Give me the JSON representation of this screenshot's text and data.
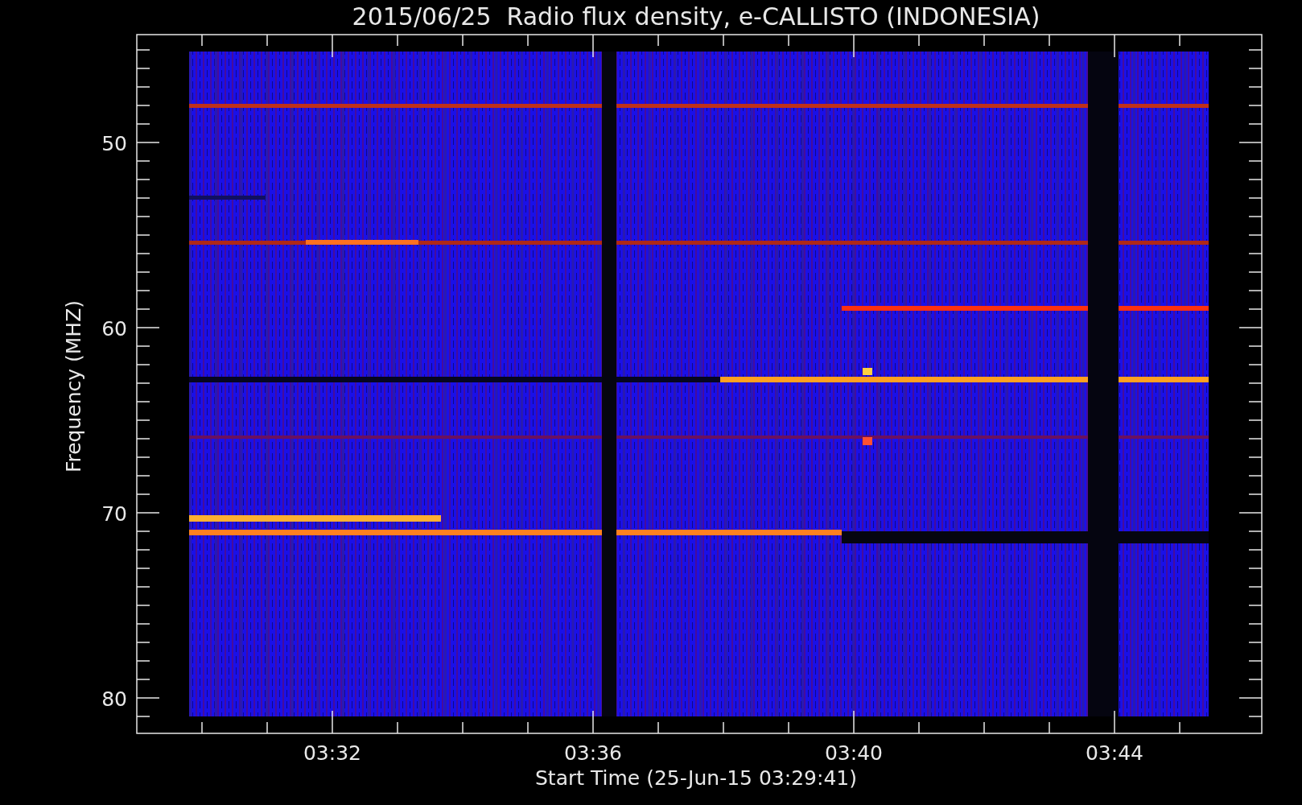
{
  "title": "2015/06/25  Radio flux density, e-CALLISTO (INDONESIA)",
  "y_axis": {
    "label": "Frequency (MHZ)",
    "ticks": [
      "50",
      "60",
      "70",
      "80"
    ]
  },
  "x_axis": {
    "label": "Start Time (25-Jun-15 03:29:41)",
    "ticks": [
      "03:32",
      "03:36",
      "03:40",
      "03:44"
    ]
  }
}
